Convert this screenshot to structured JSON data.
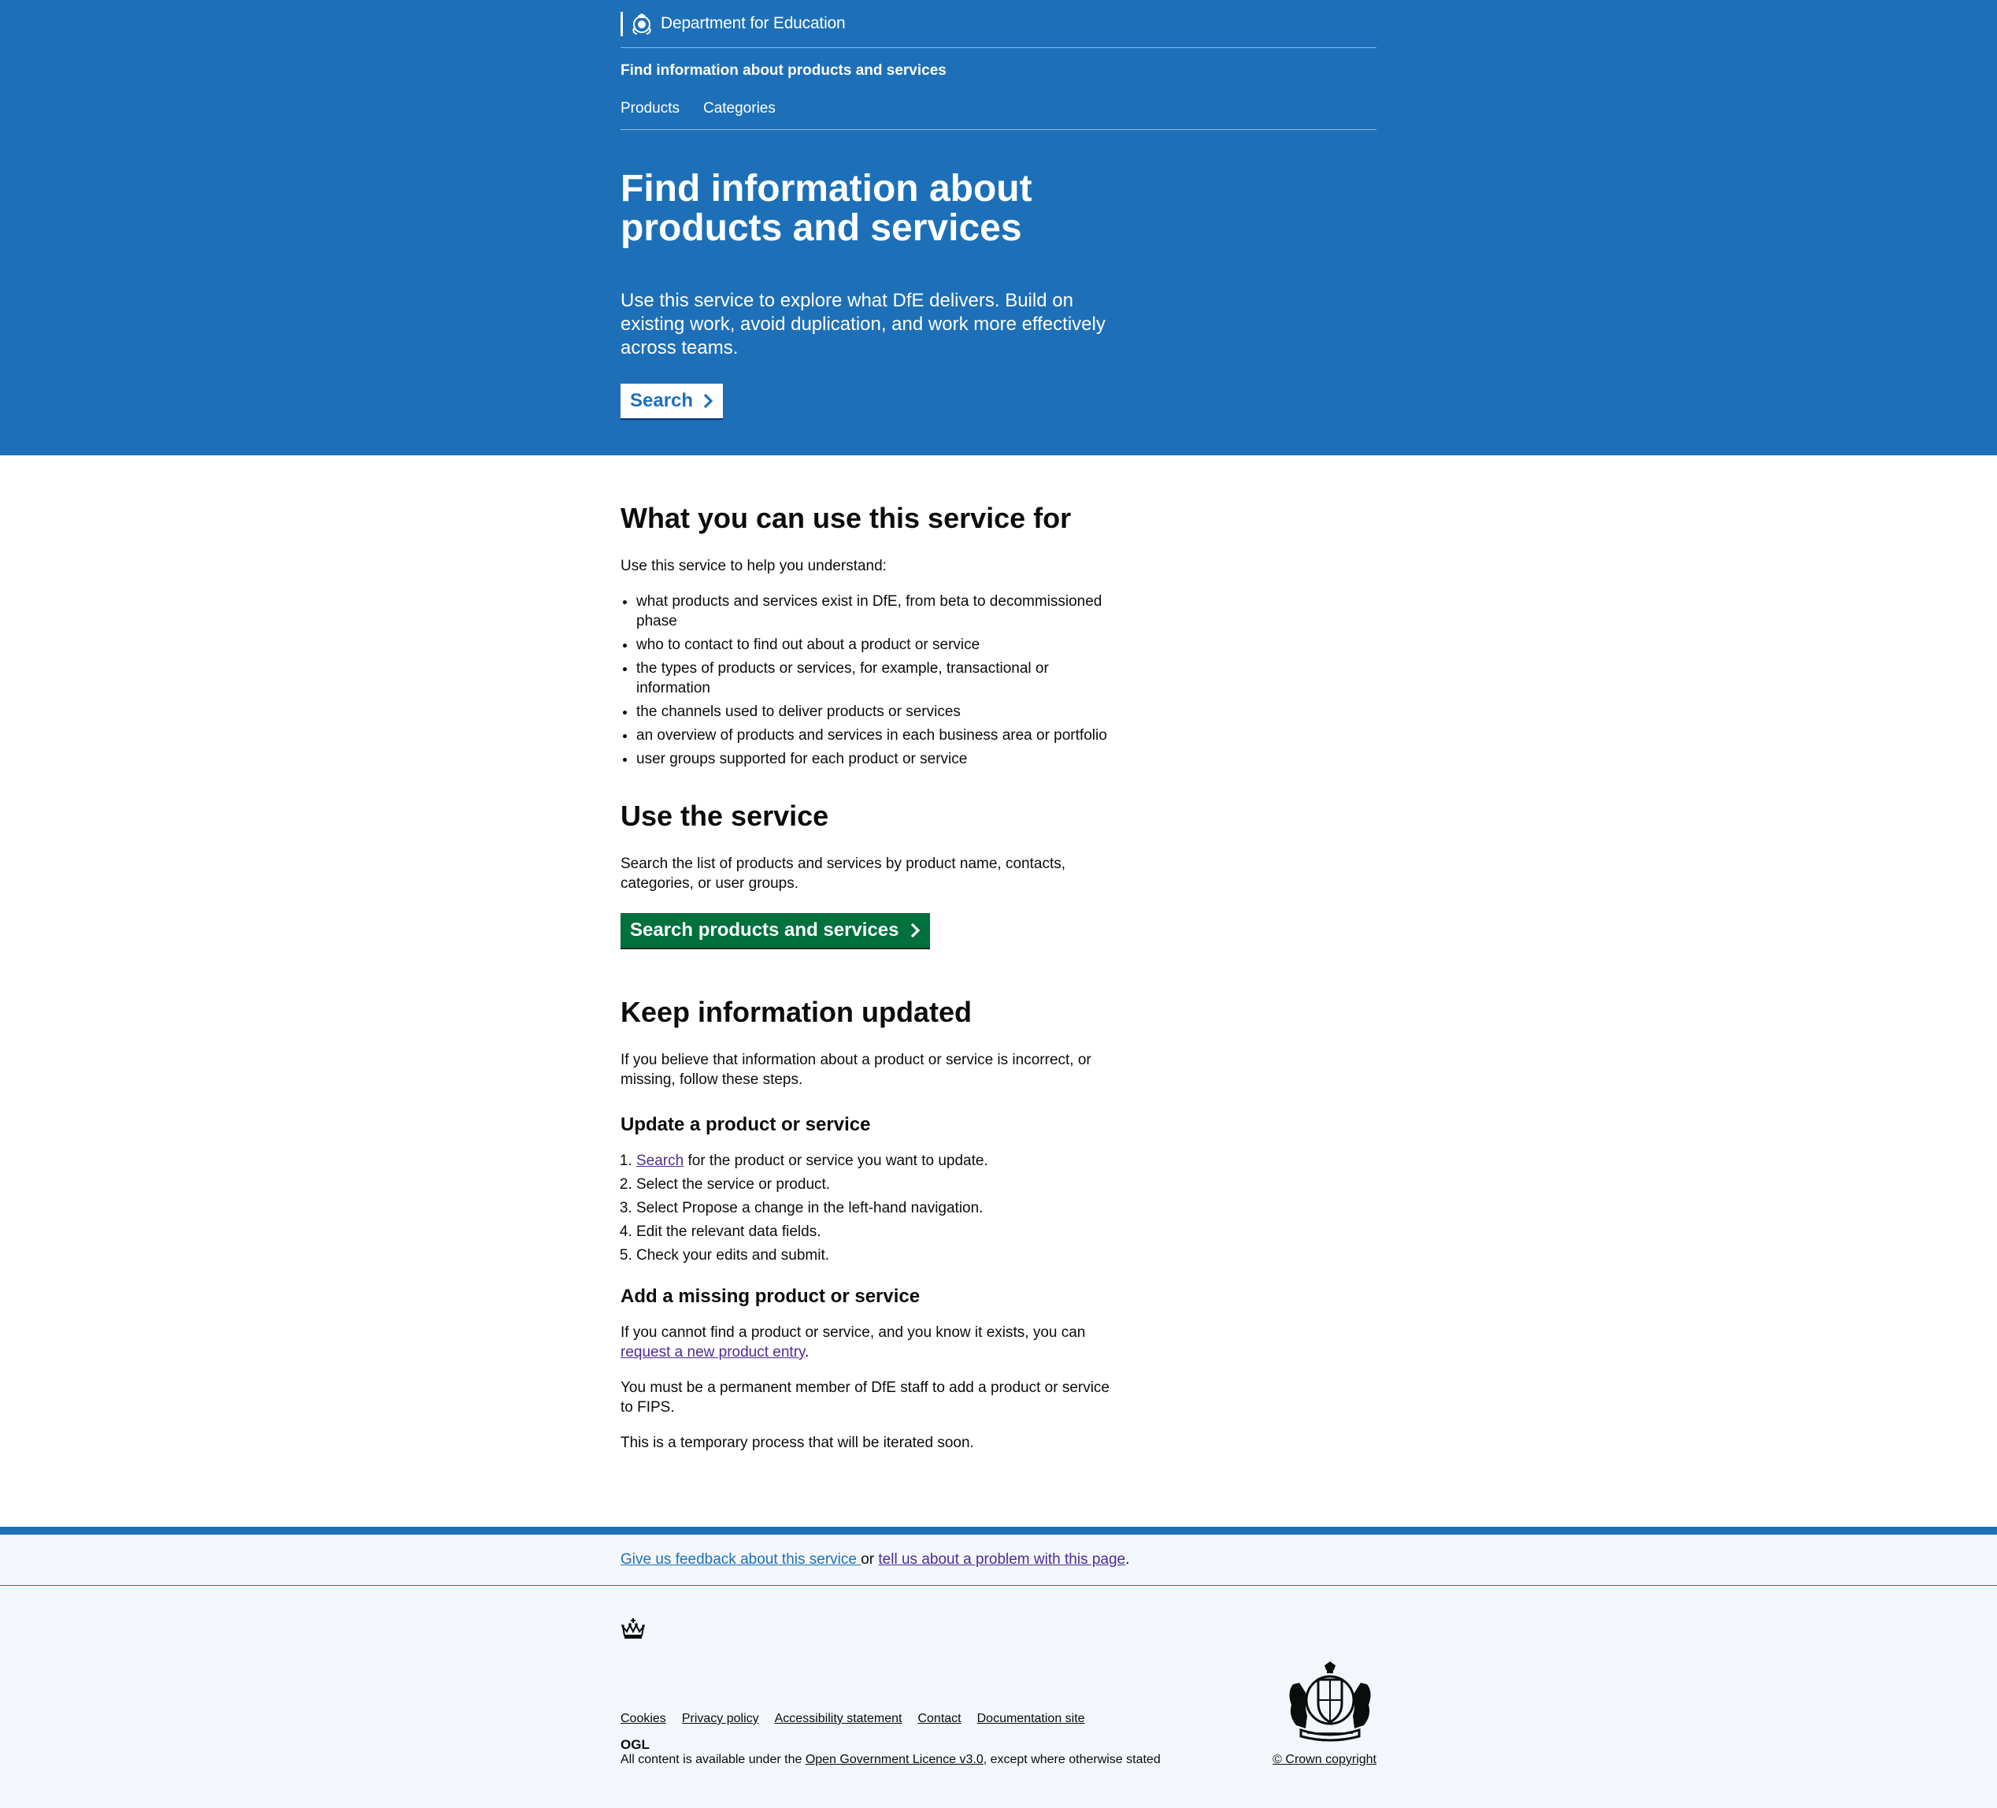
{
  "header": {
    "department": "Department for Education",
    "service_name": "Find information about products and services",
    "nav": [
      {
        "label": "Products"
      },
      {
        "label": "Categories"
      }
    ]
  },
  "hero": {
    "title": "Find information about products and services",
    "lead": "Use this service to explore what DfE delivers. Build on existing work, avoid duplication, and work more effectively across teams.",
    "button_label": "Search"
  },
  "what": {
    "heading": "What you can use this service for",
    "intro": "Use this service to help you understand:",
    "items": [
      "what products and services exist in DfE, from beta to decommissioned phase",
      "who to contact to find out about a product or service",
      "the types of products or services, for example, transactional or information",
      "the channels used to deliver products or services",
      "an overview of products and services in each business area or portfolio",
      "user groups supported for each product or service"
    ]
  },
  "use": {
    "heading": "Use the service",
    "text": "Search the list of products and services by product name, contacts, categories, or user groups.",
    "button_label": "Search products and services"
  },
  "keep": {
    "heading": "Keep information updated",
    "text": "If you believe that information about a product or service is incorrect, or missing, follow these steps.",
    "update_heading": "Update a product or service",
    "steps": {
      "step1_link": "Search",
      "step1_rest": " for the product or service you want to update.",
      "step2": "Select the service or product.",
      "step3": "Select Propose a change in the left-hand navigation.",
      "step4": "Edit the relevant data fields.",
      "step5": "Check your edits and submit."
    },
    "add_heading": "Add a missing product or service",
    "add_text_before": "If you cannot find a product or service, and you know it exists, you can ",
    "add_link": "request a new product entry",
    "add_text_after": ".",
    "permanent": "You must be a permanent member of DfE staff to add a product or service to FIPS.",
    "temporary": "This is a temporary process that will be iterated soon."
  },
  "footer": {
    "feedback_link": "Give us feedback about this service ",
    "feedback_or": "or ",
    "problem_link": "tell us about a problem with this page",
    "feedback_end": ".",
    "links": [
      "Cookies",
      "Privacy policy",
      "Accessibility statement",
      "Contact",
      "Documentation site"
    ],
    "ogl_label": "OGL",
    "licence_before": "All content is available under the ",
    "licence_link": "Open Government Licence v3.0",
    "licence_after": ", except where otherwise stated",
    "copyright": "© Crown copyright"
  },
  "colors": {
    "brand_blue": "#1d70b8",
    "button_green": "#00703c",
    "link_visited": "#4c2c92",
    "footer_bg": "#f3f6fb"
  }
}
